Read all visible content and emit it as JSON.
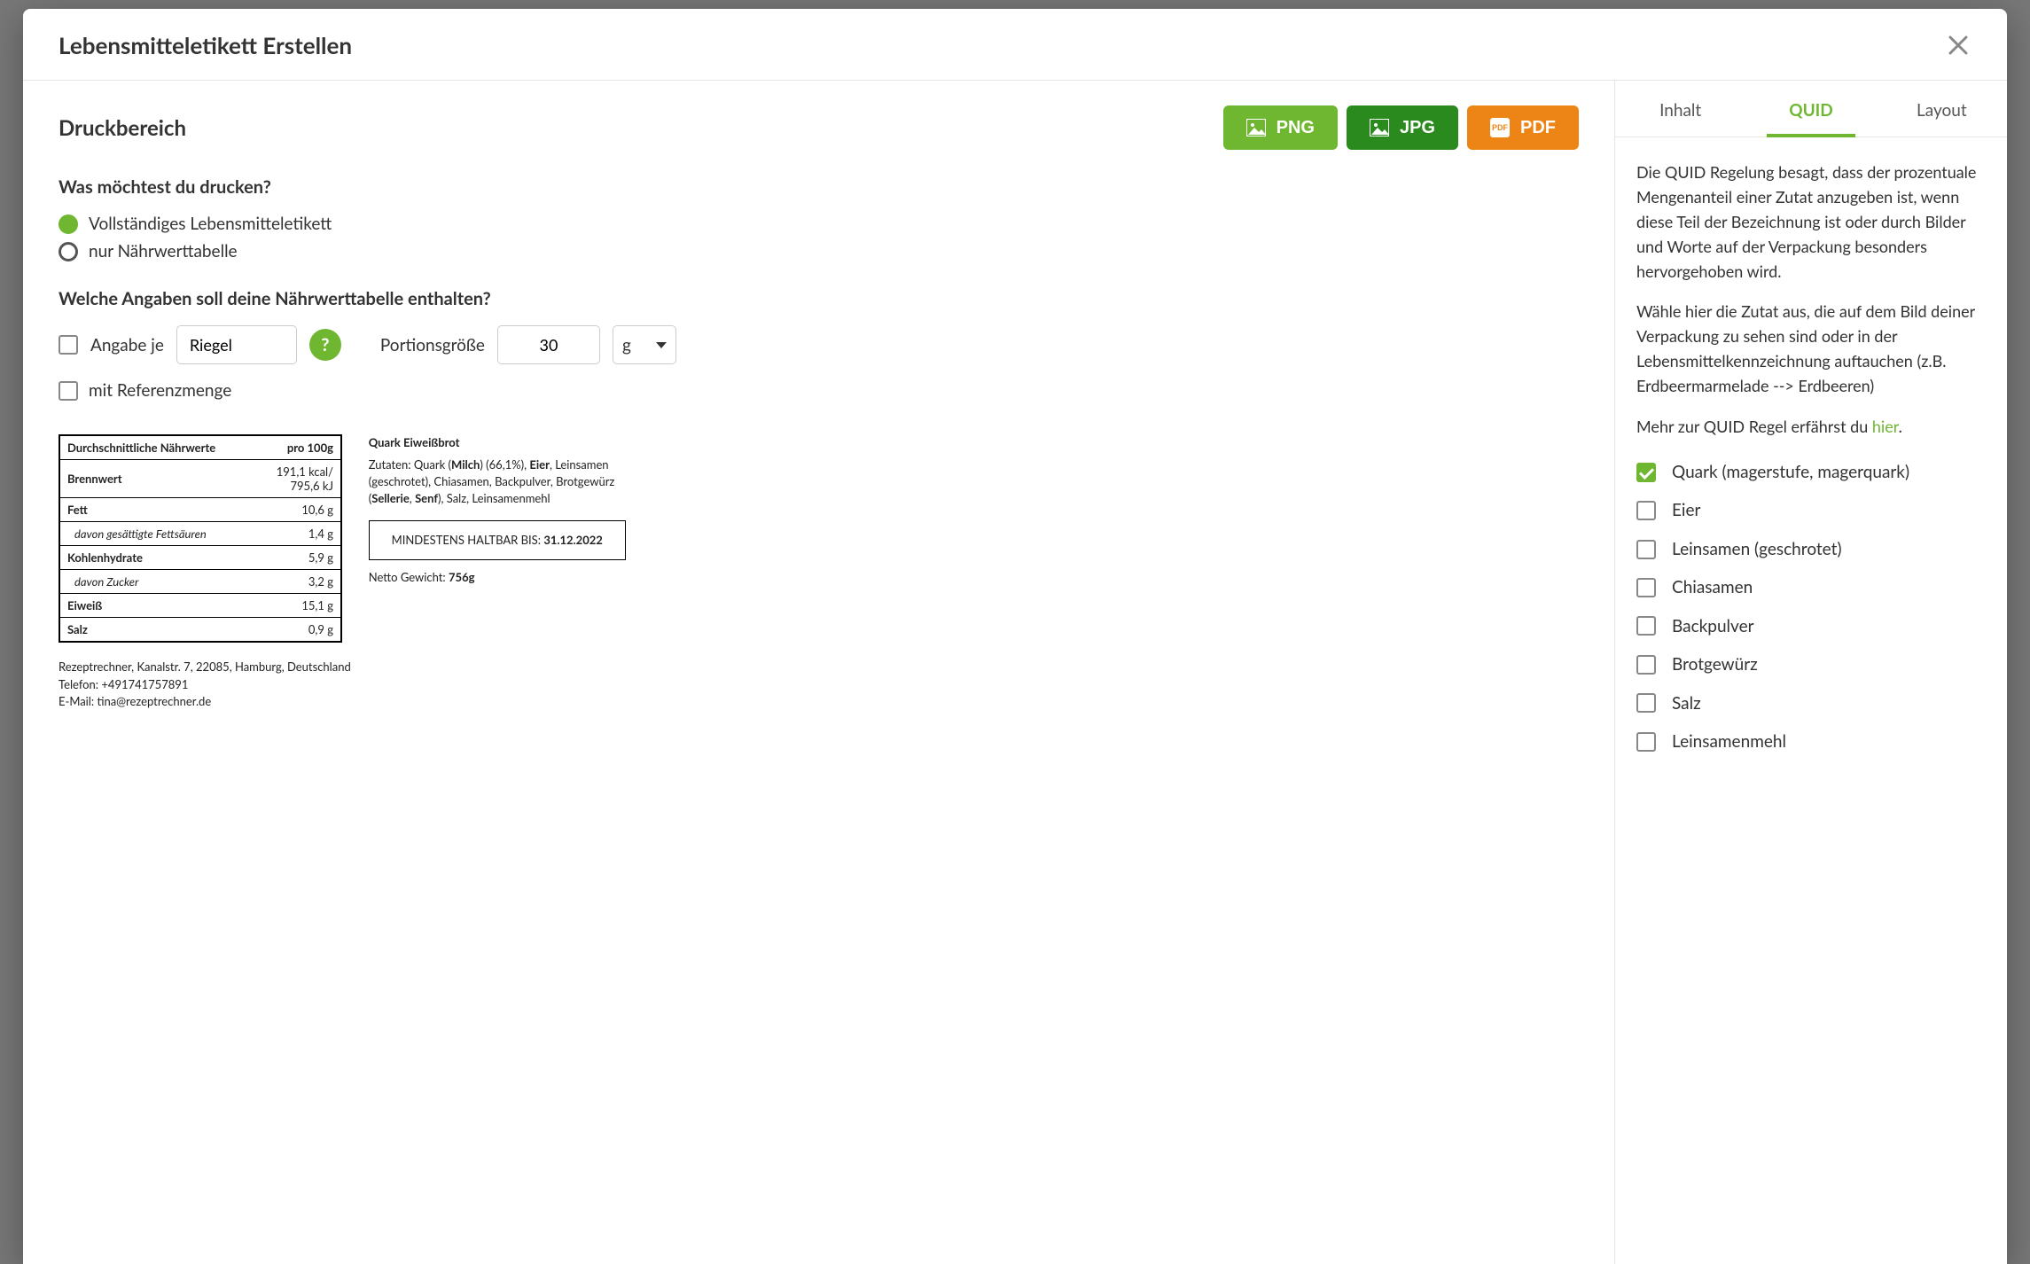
{
  "modal": {
    "title": "Lebensmitteletikett Erstellen"
  },
  "left": {
    "section_title": "Druckbereich",
    "export": {
      "png": "PNG",
      "jpg": "JPG",
      "pdf": "PDF"
    },
    "q1": "Was möchtest du drucken?",
    "radio_full": "Vollständiges Lebensmitteletikett",
    "radio_table": "nur Nährwerttabelle",
    "q2": "Welche Angaben soll deine Nährwerttabelle enthalten?",
    "angabe_je_label": "Angabe je",
    "riegel_value": "Riegel",
    "portion_label": "Portionsgröße",
    "portion_value": "30",
    "unit_value": "g",
    "mit_referenz": "mit Referenzmenge"
  },
  "nutrition": {
    "header_left": "Durchschnittliche Nährwerte",
    "header_right": "pro 100g",
    "rows": [
      {
        "label": "Brennwert",
        "value": "191,1 kcal/\n795,6 kJ",
        "bold": true
      },
      {
        "label": "Fett",
        "value": "10,6 g",
        "bold": true
      },
      {
        "label": "davon gesättigte Fettsäuren",
        "value": "1,4 g",
        "indent": true
      },
      {
        "label": "Kohlenhydrate",
        "value": "5,9 g",
        "bold": true
      },
      {
        "label": "davon Zucker",
        "value": "3,2 g",
        "indent": true
      },
      {
        "label": "Eiweiß",
        "value": "15,1 g",
        "bold": true
      },
      {
        "label": "Salz",
        "value": "0,9 g",
        "bold": true
      }
    ],
    "footer_line1": "Rezeptrechner, Kanalstr. 7, 22085, Hamburg, Deutschland",
    "footer_line2": "Telefon: +491741757891",
    "footer_line3": "E-Mail: tina@rezeptrechner.de"
  },
  "ingredients": {
    "title": "Quark Eiweißbrot",
    "prefix": "Zutaten: ",
    "parts": [
      {
        "t": "Quark ("
      },
      {
        "t": "Milch",
        "b": true
      },
      {
        "t": ") (66,1%), "
      },
      {
        "t": "Eier",
        "b": true
      },
      {
        "t": ", Leinsamen (geschrotet), Chiasamen, Backpulver, Brotgewürz ("
      },
      {
        "t": "Sellerie",
        "b": true
      },
      {
        "t": ", "
      },
      {
        "t": "Senf",
        "b": true
      },
      {
        "t": "), Salz, Leinsamenmehl"
      }
    ],
    "best_before_label": "MINDESTENS HALTBAR BIS: ",
    "best_before_date": "31.12.2022",
    "netto_label": "Netto Gewicht: ",
    "netto_value": "756g"
  },
  "right": {
    "tabs": {
      "inhalt": "Inhalt",
      "quid": "QUID",
      "layout": "Layout"
    },
    "p1": "Die QUID Regelung besagt, dass der prozentuale Mengenanteil einer Zutat anzugeben ist, wenn diese Teil der Bezeichnung ist oder durch Bilder und Worte auf der Verpackung besonders hervorgehoben wird.",
    "p2": "Wähle hier die Zutat aus, die auf dem Bild deiner Verpackung zu sehen sind oder in der Lebensmittelkennzeichnung auftauchen (z.B. Erdbeermarmelade --> Erdbeeren)",
    "more_prefix": "Mehr zur QUID Regel erfährst du ",
    "more_link": "hier",
    "more_suffix": ".",
    "quid_items": [
      {
        "label": "Quark (magerstufe, magerquark)",
        "checked": true
      },
      {
        "label": "Eier",
        "checked": false
      },
      {
        "label": "Leinsamen (geschrotet)",
        "checked": false
      },
      {
        "label": "Chiasamen",
        "checked": false
      },
      {
        "label": "Backpulver",
        "checked": false
      },
      {
        "label": "Brotgewürz",
        "checked": false
      },
      {
        "label": "Salz",
        "checked": false
      },
      {
        "label": "Leinsamenmehl",
        "checked": false
      }
    ]
  }
}
